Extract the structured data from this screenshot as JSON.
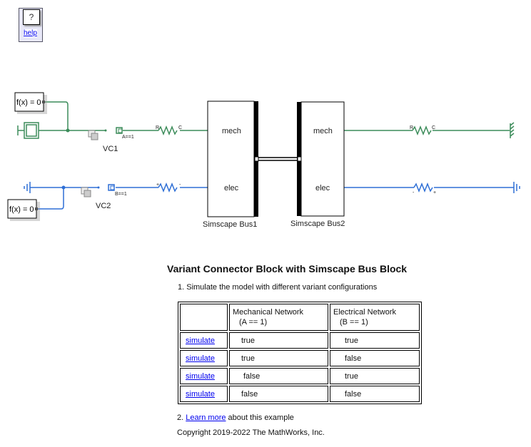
{
  "help_block": {
    "icon_label": "?",
    "link_label": "help"
  },
  "diagram": {
    "colors": {
      "mechanical": "#3c8c5a",
      "electrical": "#2e6fd6"
    },
    "mech_top": {
      "fx_label": "f(x) = 0",
      "variant_label": "VC1",
      "condition": "A==1",
      "resistor_left": "R",
      "resistor_right": "C"
    },
    "elec_bottom": {
      "fx_label": "f(x) = 0",
      "variant_label": "VC2",
      "condition": "B==1",
      "resistor_left": "+",
      "resistor_right": "-"
    },
    "bus1": {
      "name": "Simscape Bus1",
      "port_top": "mech",
      "port_bottom": "elec"
    },
    "bus2": {
      "name": "Simscape Bus2",
      "port_top": "mech",
      "port_bottom": "elec"
    },
    "right_mech": {
      "resistor_left": "R",
      "resistor_right": "C"
    },
    "right_elec": {
      "resistor_left": "-",
      "resistor_right": "+"
    }
  },
  "doc": {
    "title": "Variant Connector Block with Simscape Bus Block",
    "step1": "1. Simulate the model with different variant configurations",
    "table": {
      "headers": [
        {
          "line1": "",
          "line2": ""
        },
        {
          "line1": "Mechanical Network",
          "line2": "(A == 1)"
        },
        {
          "line1": "Electrical Network",
          "line2": "(B == 1)"
        }
      ],
      "rows": [
        {
          "action": "simulate",
          "mech": "true",
          "elec": "true"
        },
        {
          "action": "simulate",
          "mech": "true",
          "elec": "false"
        },
        {
          "action": "simulate",
          "mech": "false",
          "elec": "true"
        },
        {
          "action": "simulate",
          "mech": "false",
          "elec": "false"
        }
      ]
    },
    "step2_prefix": "2. ",
    "step2_link": "Learn more",
    "step2_suffix": " about this example",
    "copyright": "Copyright 2019-2022 The MathWorks, Inc."
  }
}
